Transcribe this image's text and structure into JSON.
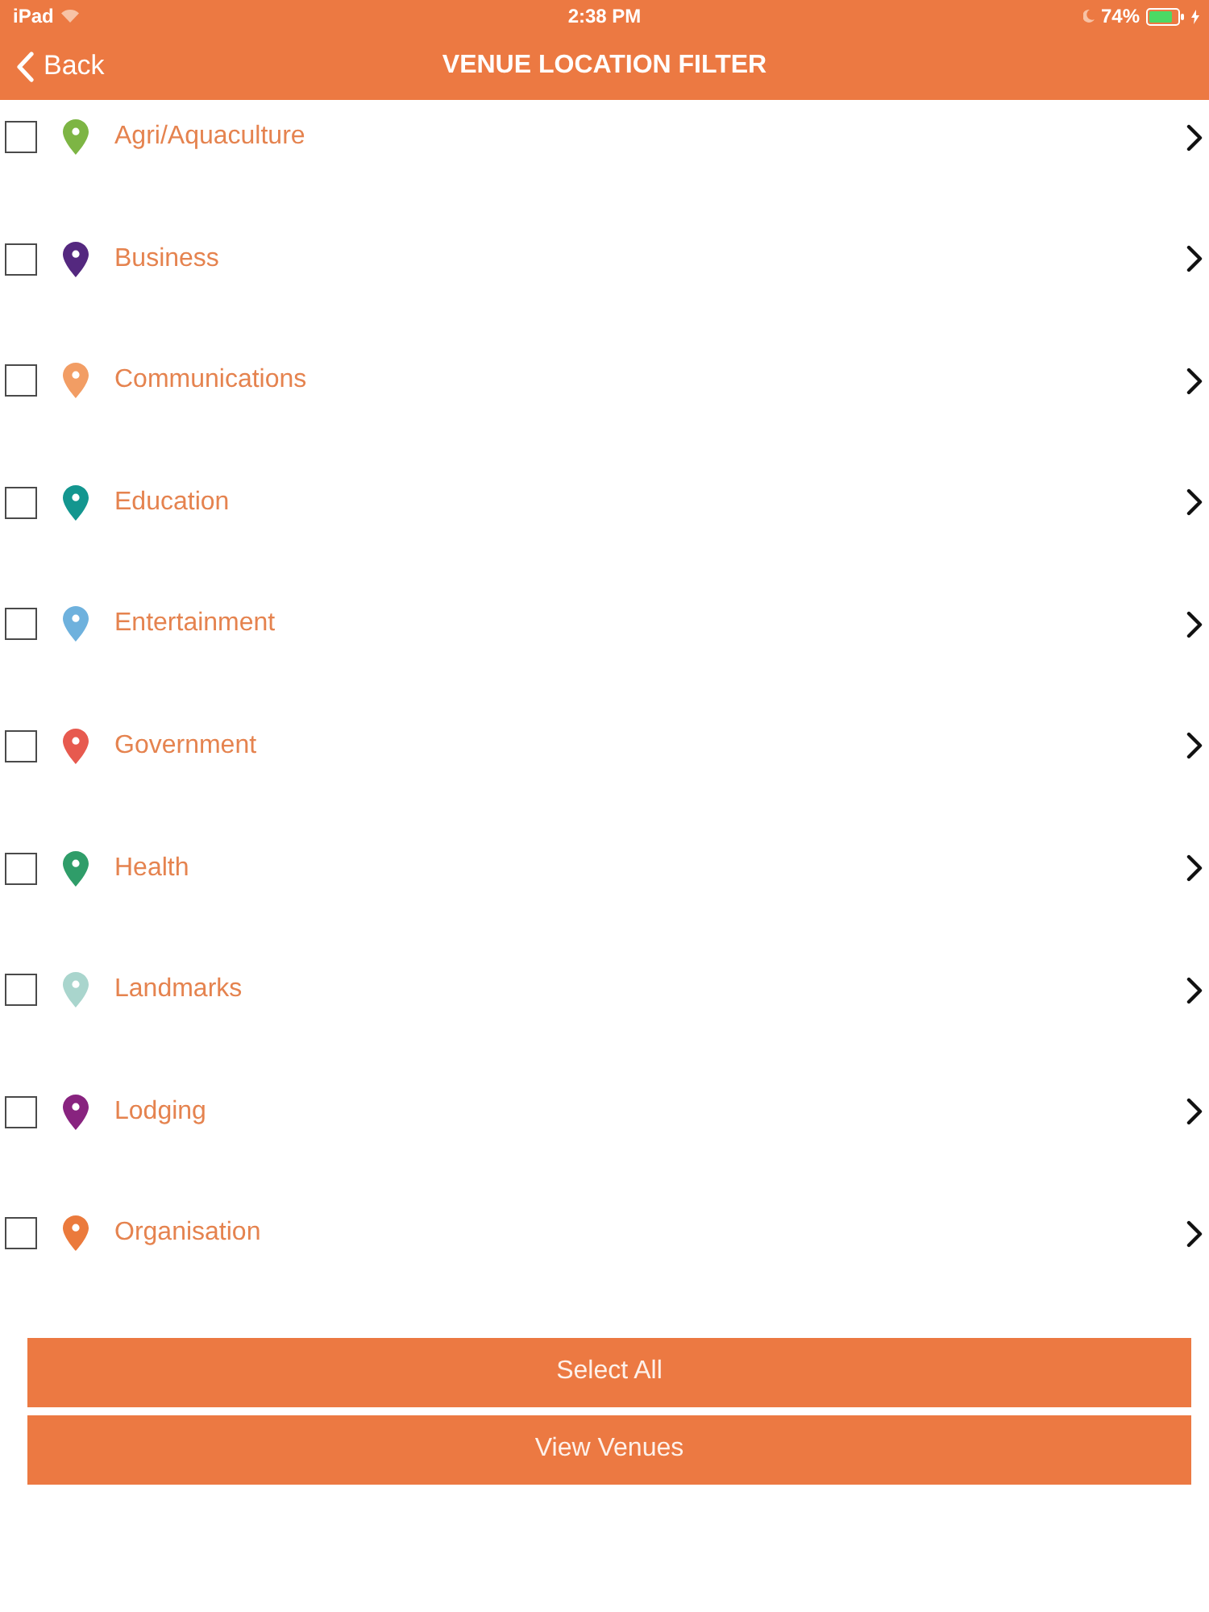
{
  "status_bar": {
    "device": "iPad",
    "time": "2:38 PM",
    "battery": "74%"
  },
  "nav_bar": {
    "back": "Back",
    "title": "VENUE LOCATION FILTER"
  },
  "categories": [
    {
      "label": "Agri/Aquaculture",
      "color": "#7db544",
      "checked": false
    },
    {
      "label": "Business",
      "color": "#54287f",
      "checked": false
    },
    {
      "label": "Communications",
      "color": "#f29d64",
      "checked": false
    },
    {
      "label": "Education",
      "color": "#13968f",
      "checked": false
    },
    {
      "label": "Entertainment",
      "color": "#6eb1dd",
      "checked": false
    },
    {
      "label": "Government",
      "color": "#e75a4f",
      "checked": false
    },
    {
      "label": "Health",
      "color": "#2f9d69",
      "checked": false
    },
    {
      "label": "Landmarks",
      "color": "#a9d5cd",
      "checked": false
    },
    {
      "label": "Lodging",
      "color": "#88237f",
      "checked": false
    },
    {
      "label": "Organisation",
      "color": "#eb7a3c",
      "checked": false
    }
  ],
  "buttons": [
    "Select All",
    "View Venues"
  ]
}
